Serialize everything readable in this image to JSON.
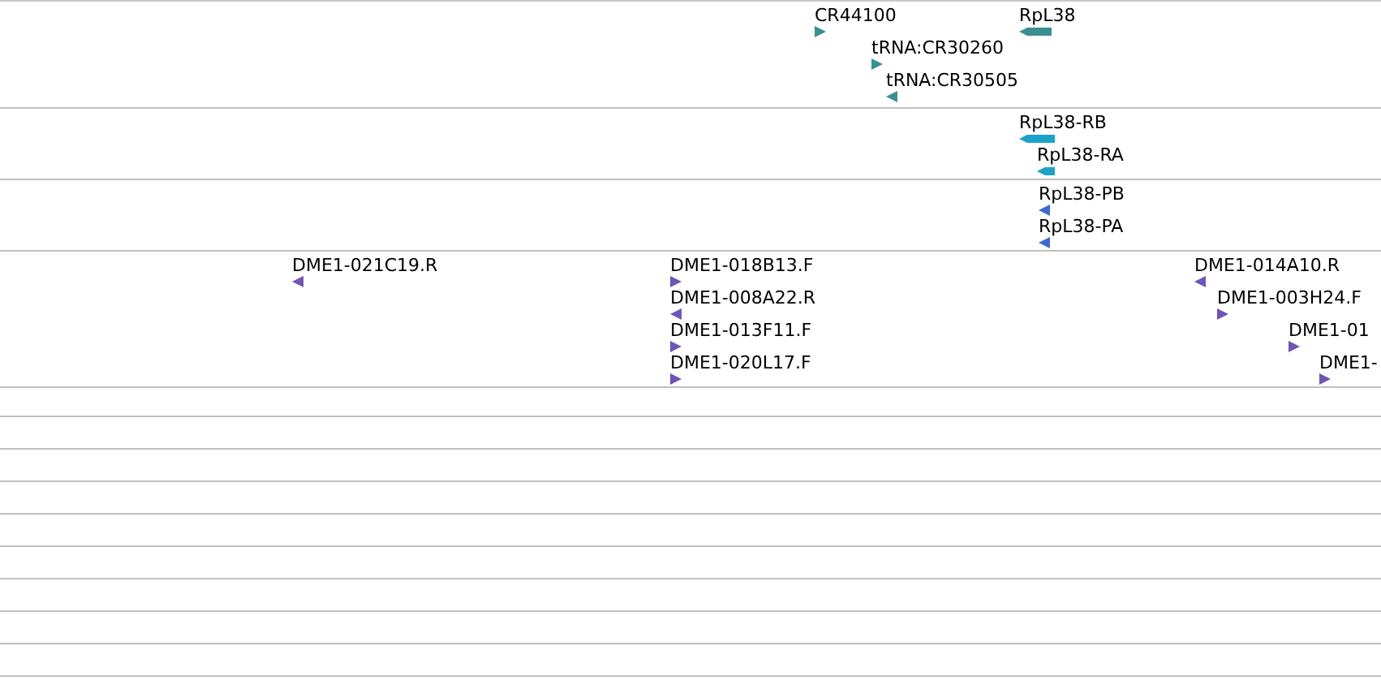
{
  "tracks": [
    {
      "color": "#3a9090",
      "features": [
        {
          "label": "CR44100",
          "reverse": false,
          "kind": "arrow"
        },
        {
          "label": "RpL38",
          "reverse": true,
          "kind": "bar"
        },
        {
          "label": "tRNA:CR30260",
          "reverse": false,
          "kind": "arrow"
        },
        {
          "label": "tRNA:CR30505",
          "reverse": true,
          "kind": "arrow"
        }
      ]
    },
    {
      "color": "#1ba3c6",
      "features": [
        {
          "label": "RpL38-RB",
          "reverse": true,
          "kind": "bar"
        },
        {
          "label": "RpL38-RA",
          "reverse": true,
          "kind": "bar"
        }
      ]
    },
    {
      "color": "#3a6ad4",
      "features": [
        {
          "label": "RpL38-PB",
          "reverse": true,
          "kind": "arrow"
        },
        {
          "label": "RpL38-PA",
          "reverse": true,
          "kind": "arrow"
        }
      ]
    },
    {
      "color": "#6f55b5",
      "features": [
        {
          "label": "DME1-021C19.R",
          "reverse": true,
          "kind": "arrow"
        },
        {
          "label": "DME1-018B13.F",
          "reverse": false,
          "kind": "arrow"
        },
        {
          "label": "DME1-008A22.R",
          "reverse": true,
          "kind": "arrow"
        },
        {
          "label": "DME1-013F11.F",
          "reverse": false,
          "kind": "arrow"
        },
        {
          "label": "DME1-020L17.F",
          "reverse": false,
          "kind": "arrow"
        },
        {
          "label": "DME1-014A10.R",
          "reverse": true,
          "kind": "arrow"
        },
        {
          "label": "DME1-003H24.F",
          "reverse": false,
          "kind": "arrow"
        },
        {
          "label": "DME1-01",
          "reverse": false,
          "kind": "arrow"
        },
        {
          "label": "DME1-",
          "reverse": false,
          "kind": "arrow"
        }
      ]
    }
  ]
}
